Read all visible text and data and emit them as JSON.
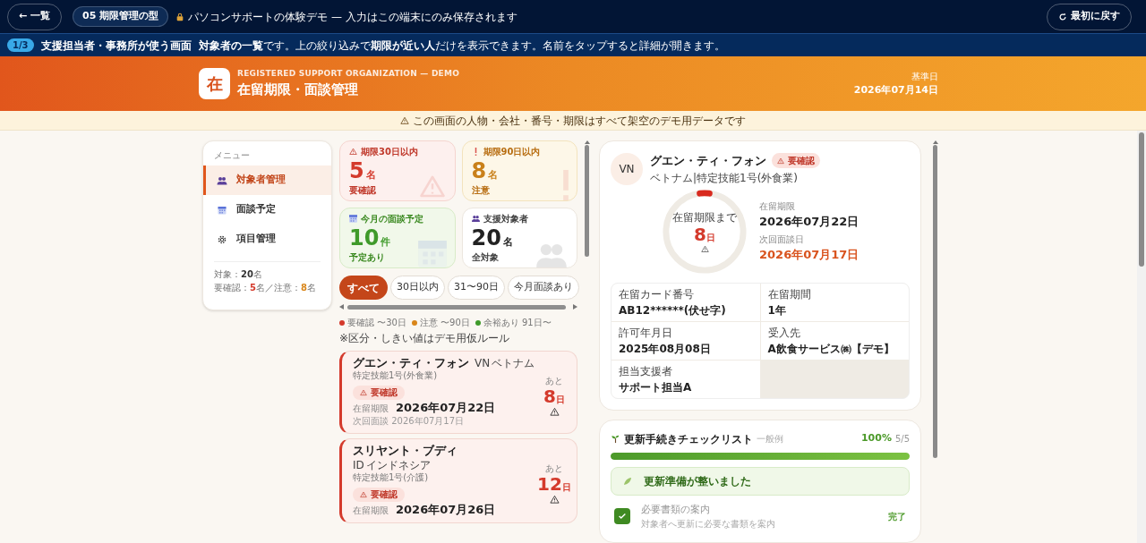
{
  "top_bar": {
    "back_button": "← 一覧",
    "pattern_badge": "05 期限管理の型",
    "notice": "パソコンサポートの体験デモ — 入力はこの端末にのみ保存されます",
    "reset_button": "最初に戻す"
  },
  "guide_bar": {
    "step": "1/3",
    "role": "支援担当者・事務所が使う画面",
    "message": "**対象者の一覧**です。上の絞り込みで**期限が近い人**だけを表示できます。名前をタップすると詳細が開きます。"
  },
  "header": {
    "logo": "在",
    "subtitle": "REGISTERED SUPPORT ORGANIZATION — DEMO",
    "title": "在留期限・面談管理",
    "date_label": "基準日",
    "date": "2026年07月14日"
  },
  "demo_notice": "この画面の人物・会社・番号・期限はすべて架空のデモ用データです",
  "sidebar": {
    "heading": "メニュー",
    "items": [
      {
        "label": "対象者管理",
        "selected": true
      },
      {
        "label": "面談予定",
        "selected": false
      },
      {
        "label": "項目管理",
        "selected": false
      }
    ],
    "summary": {
      "total_label": "対象：",
      "total": "20",
      "total_unit": "名",
      "urgent_label": "要確認：",
      "urgent": "5",
      "urgent_unit": "名／",
      "caution_label": "注意：",
      "caution": "8",
      "caution_unit": "名"
    }
  },
  "stats": [
    {
      "kind": "danger",
      "label": "期限30日以内",
      "value": "5",
      "unit": "名",
      "note": "要確認"
    },
    {
      "kind": "warning",
      "label": "期限90日以内",
      "value": "8",
      "unit": "名",
      "note": "注意"
    },
    {
      "kind": "success",
      "label": "今月の面談予定",
      "value": "10",
      "unit": "件",
      "note": "予定あり"
    },
    {
      "kind": "neutral",
      "label": "支援対象者",
      "value": "20",
      "unit": "名",
      "note": "全対象"
    }
  ],
  "filters": [
    {
      "label": "すべて",
      "selected": true
    },
    {
      "label": "30日以内",
      "selected": false
    },
    {
      "label": "31〜90日",
      "selected": false
    },
    {
      "label": "今月面談あり",
      "selected": false
    }
  ],
  "legend": [
    {
      "label": "要確認 〜30日",
      "color": "#d43a2c"
    },
    {
      "label": "注意 〜90日",
      "color": "#d9861a"
    },
    {
      "label": "余裕あり 91日〜",
      "color": "#3f9a2a"
    }
  ],
  "rule_note": "※区分・しきい値はデモ用仮ルール",
  "people": [
    {
      "name": "グエン・ティ・フォン",
      "country_code": "VN",
      "country": "ベトナム",
      "visa": "特定技能1号(外食業)",
      "status": "要確認",
      "expiry_label": "在留期限",
      "expiry": "2026年07月22日",
      "next_label": "次回面談",
      "next": "2026年07月17日",
      "days_label": "あと",
      "days": "8",
      "days_unit": "日"
    },
    {
      "name": "スリヤント・ブディ",
      "country_code": "ID",
      "country": "インドネシア",
      "visa": "特定技能1号(介護)",
      "status": "要確認",
      "expiry_label": "在留期限",
      "expiry": "2026年07月26日",
      "days_label": "あと",
      "days": "12",
      "days_unit": "日"
    }
  ],
  "detail": {
    "avatar": "VN",
    "name": "グエン・ティ・フォン",
    "status": "要確認",
    "subtitle": "ベトナム|特定技能1号(外食業)",
    "ring": {
      "label": "在留期限まで",
      "days": "8",
      "unit": "日",
      "level": 0.04
    },
    "dates": [
      {
        "label": "在留期限",
        "value": "2026年07月22日"
      },
      {
        "label": "次回面談日",
        "value": "2026年07月17日"
      }
    ],
    "fields": [
      {
        "label": "在留カード番号",
        "value": "AB12******(伏せ字)"
      },
      {
        "label": "在留期間",
        "value": "1年"
      },
      {
        "label": "許可年月日",
        "value": "2025年08月08日"
      },
      {
        "label": "受入先",
        "value": "A飲食サービス㈱【デモ】"
      },
      {
        "label": "担当支援者",
        "value": "サポート担当A"
      }
    ]
  },
  "checklist": {
    "title": "更新手続きチェックリスト",
    "note": "一般例",
    "percent": "100%",
    "count": "5/5",
    "level": 1,
    "done_message": "更新準備が整いました",
    "items": [
      {
        "title": "必要書類の案内",
        "description": "対象者へ更新に必要な書類を案内",
        "checked": true,
        "status": "完了"
      }
    ]
  }
}
